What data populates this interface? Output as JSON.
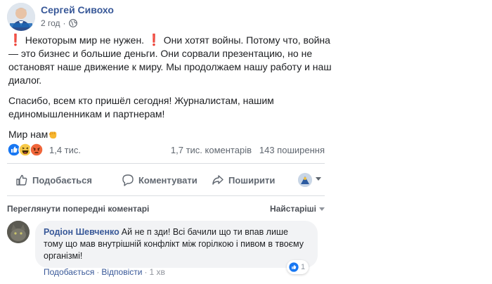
{
  "post": {
    "author": "Сергей Сивохо",
    "time": "2 год",
    "separator": "·",
    "paragraphs": [
      {
        "excl1": "❗",
        "seg1": " Некоторым мир не нужен. ",
        "excl2": "❗",
        "seg2": " Они хотят войны. Потому что, война — это бизнес и большие деньги. Они сорвали презентацию, но не остановят наше движение к миру. Мы продолжаем нашу работу и наш диалог."
      }
    ],
    "paragraph2": "Спасибо, всем кто пришёл сегодня! Журналистам, нашим единомышленникам и партнерам!",
    "paragraph3": "Мир нам"
  },
  "reactions": {
    "icons": [
      "like-reaction",
      "haha-reaction",
      "angry-reaction"
    ],
    "count": "1,4 тис.",
    "comments": "1,7 тис. коментарів",
    "shares": "143 поширення"
  },
  "actions": {
    "like": "Подобається",
    "comment": "Коментувати",
    "share": "Поширити"
  },
  "comments_section": {
    "previous": "Переглянути попередні коментарі",
    "sort": "Найстаріші"
  },
  "comment": {
    "author": "Родіон Шевченко",
    "text": "Ай не п  зди! Всі бачили що ти впав лише тому що мав внутрішній конфлікт між горілкою і пивом в твоєму організмі!",
    "like_label": "Подобається",
    "reply_label": "Відповісти",
    "time": "1 хв",
    "sep": "·",
    "like_count": "1"
  },
  "colors": {
    "link": "#385898",
    "meta": "#606770",
    "bubble": "#f2f3f5",
    "like_blue": "#1877f2"
  }
}
